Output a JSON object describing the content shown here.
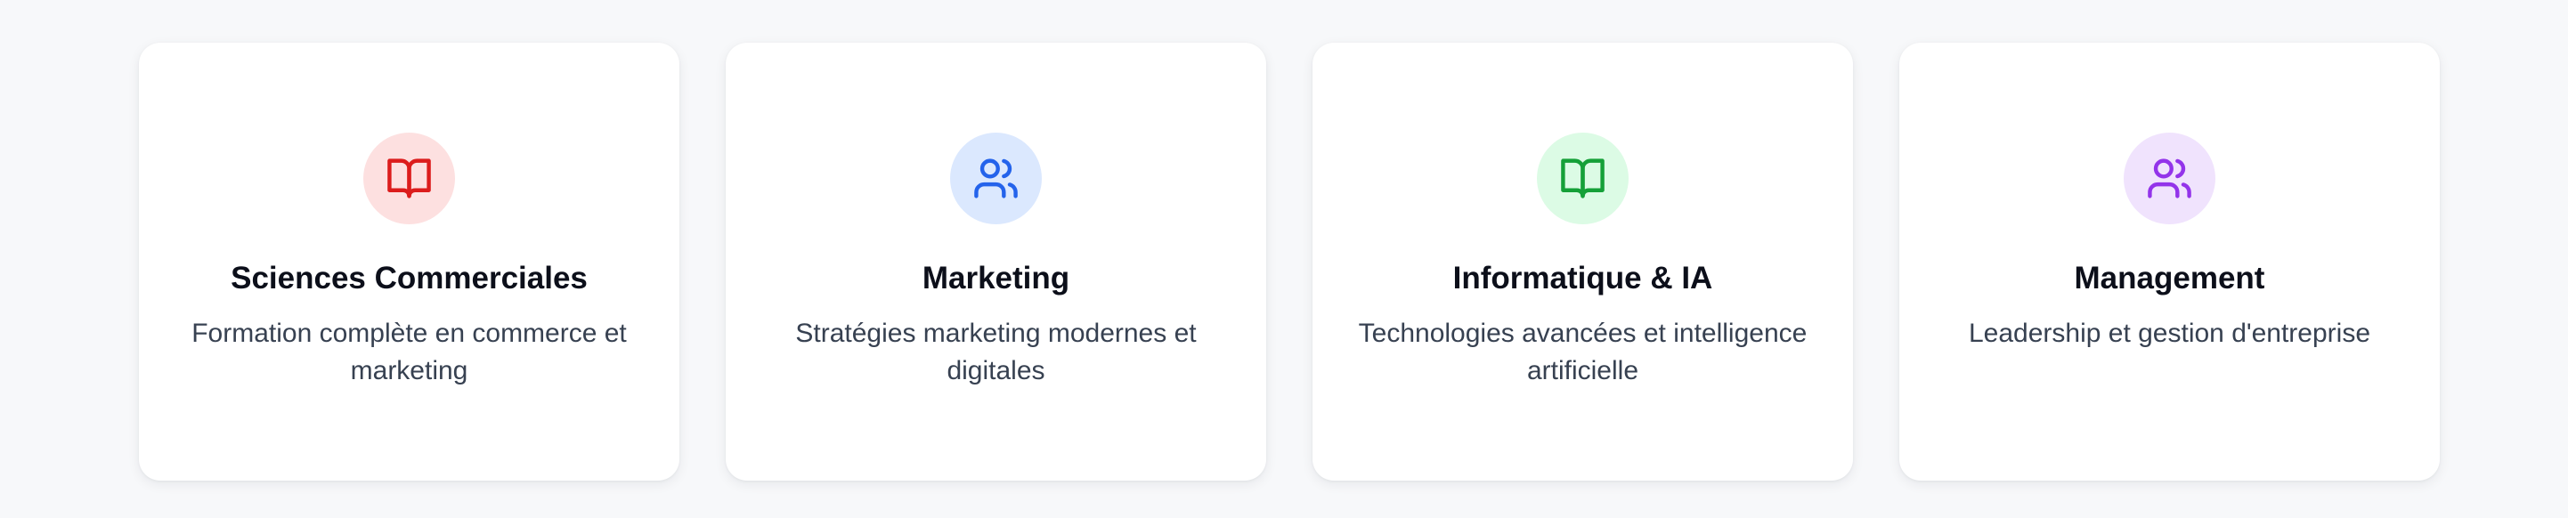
{
  "cards": [
    {
      "title": "Sciences Commerciales",
      "description": "Formation complète en commerce et marketing",
      "icon": "book-open-icon",
      "icon_color": "#dc1c1c",
      "icon_bg": "#fde0e0"
    },
    {
      "title": "Marketing",
      "description": "Stratégies marketing modernes et digitales",
      "icon": "users-icon",
      "icon_color": "#2463eb",
      "icon_bg": "#dbe8fe"
    },
    {
      "title": "Informatique & IA",
      "description": "Technologies avancées et intelligence artificielle",
      "icon": "book-open-icon",
      "icon_color": "#15a038",
      "icon_bg": "#dcfbe5"
    },
    {
      "title": "Management",
      "description": "Leadership et gestion d'entreprise",
      "icon": "users-icon",
      "icon_color": "#9333ea",
      "icon_bg": "#f0e3fd"
    }
  ]
}
